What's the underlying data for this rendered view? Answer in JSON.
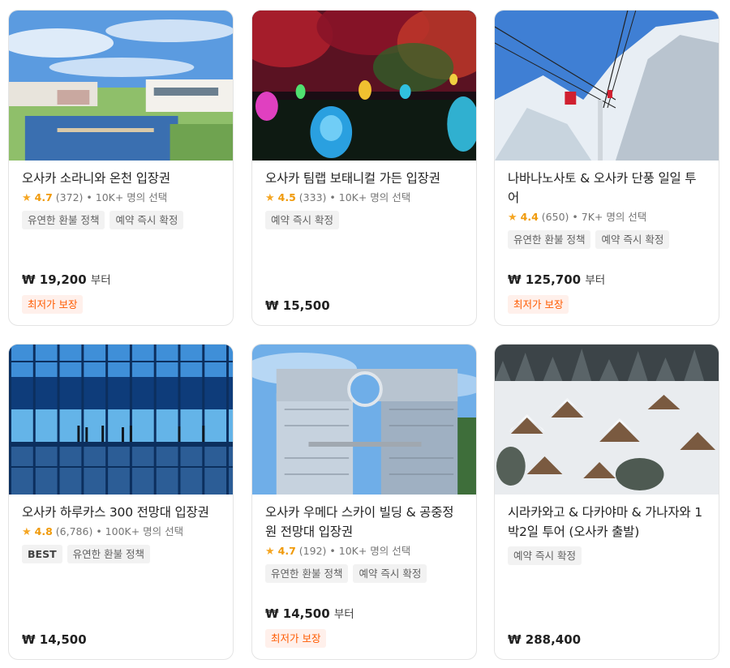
{
  "cards": [
    {
      "title": "오사카 소라니와 온천 입장권",
      "rating": "4.7",
      "reviews": "(372)",
      "booked": "• 10K+ 명의 선택",
      "tags": [
        "유연한 환불 정책",
        "예약 즉시 확정"
      ],
      "price": "₩ 19,200",
      "price_suffix": "부터",
      "badge": "최저가 보장"
    },
    {
      "title": "오사카 팀랩 보태니컬 가든 입장권",
      "rating": "4.5",
      "reviews": "(333)",
      "booked": "• 10K+ 명의 선택",
      "tags": [
        "예약 즉시 확정"
      ],
      "price": "₩ 15,500",
      "price_suffix": "",
      "badge": ""
    },
    {
      "title": "나바나노사토 & 오사카 단풍 일일 투어",
      "rating": "4.4",
      "reviews": "(650)",
      "booked": "• 7K+ 명의 선택",
      "tags": [
        "유연한 환불 정책",
        "예약 즉시 확정"
      ],
      "price": "₩ 125,700",
      "price_suffix": "부터",
      "badge": "최저가 보장"
    },
    {
      "title": "오사카 하루카스 300 전망대 입장권",
      "rating": "4.8",
      "reviews": "(6,786)",
      "booked": "• 100K+ 명의 선택",
      "tags": [
        "BEST",
        "유연한 환불 정책"
      ],
      "price": "₩ 14,500",
      "price_suffix": "",
      "badge": ""
    },
    {
      "title": "오사카 우메다 스카이 빌딩 & 공중정원 전망대 입장권",
      "rating": "4.7",
      "reviews": "(192)",
      "booked": "• 10K+ 명의 선택",
      "tags": [
        "유연한 환불 정책",
        "예약 즉시 확정"
      ],
      "price": "₩ 14,500",
      "price_suffix": "부터",
      "badge": "최저가 보장"
    },
    {
      "title": "시라카와고 & 다카야마 & 가나자와 1박2일 투어 (오사카 출발)",
      "rating": "",
      "reviews": "",
      "booked": "",
      "tags": [
        "예약 즉시 확정"
      ],
      "price": "₩ 288,400",
      "price_suffix": "",
      "badge": ""
    }
  ],
  "colors": {
    "star": "#f5a623",
    "score": "#f09a0a",
    "badge_text": "#ff5b00",
    "badge_bg": "#fff0eb",
    "tag_bg": "#f2f2f2"
  },
  "icons": {
    "rating": "star-icon"
  }
}
